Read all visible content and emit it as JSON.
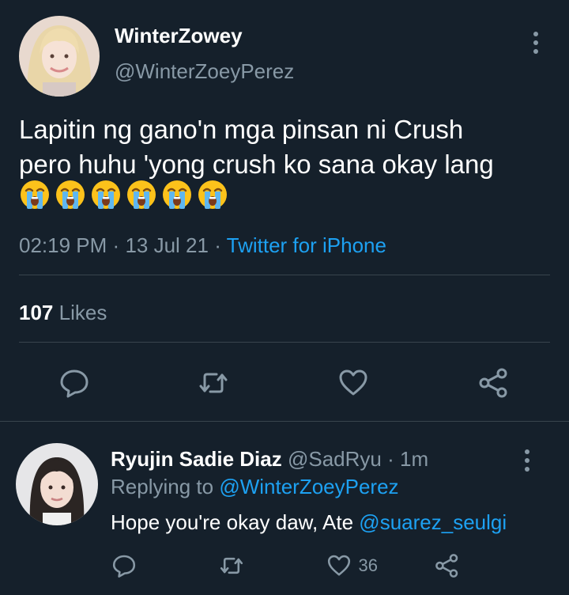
{
  "tweet": {
    "display_name": "WinterZowey",
    "handle": "@WinterZoeyPerez",
    "text_line1": "Lapitin ng gano'n mga pinsan ni Crush",
    "text_line2": "pero huhu 'yong crush ko sana okay lang",
    "emoji_count": 6,
    "emoji_name": "loudly-crying-face",
    "time": "02:19 PM",
    "sep1": "·",
    "date": "13 Jul 21",
    "sep2": "·",
    "source": "Twitter for iPhone",
    "likes_count": "107",
    "likes_label": "Likes"
  },
  "reply": {
    "display_name": "Ryujin Sadie Diaz",
    "handle": "@SadRyu",
    "sep": "·",
    "age": "1m",
    "replying_label": "Replying to",
    "replying_handle": "@WinterZoeyPerez",
    "text": "Hope you're okay daw, Ate",
    "mention": "@suarez_seulgi",
    "like_count": "36"
  },
  "colors": {
    "background": "#15202b",
    "muted": "#8899a6",
    "link": "#1da1f2",
    "divider": "#38444d"
  },
  "icons": [
    "more-vertical-icon",
    "reply-icon",
    "retweet-icon",
    "like-icon",
    "share-icon"
  ]
}
